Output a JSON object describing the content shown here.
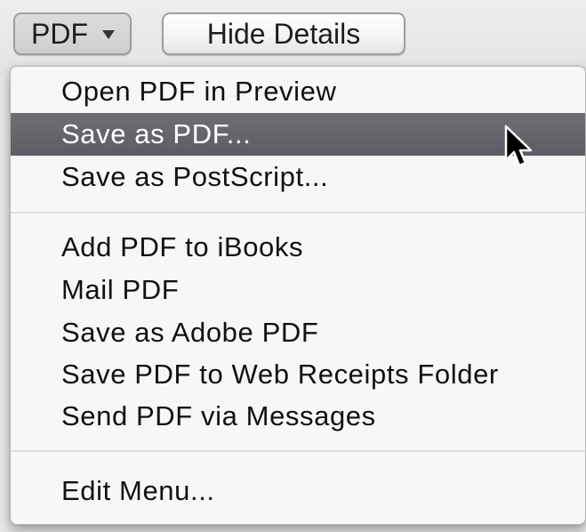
{
  "toolbar": {
    "pdf_label": "PDF",
    "hide_details_label": "Hide Details"
  },
  "menu": {
    "items": [
      {
        "label": "Open PDF in Preview"
      },
      {
        "label": "Save as PDF..."
      },
      {
        "label": "Save as PostScript..."
      },
      {
        "label": "Add PDF to iBooks"
      },
      {
        "label": "Mail PDF"
      },
      {
        "label": "Save as Adobe PDF"
      },
      {
        "label": "Save PDF to Web Receipts Folder"
      },
      {
        "label": "Send PDF via Messages"
      },
      {
        "label": "Edit Menu..."
      }
    ],
    "highlighted_index": 1,
    "highlight_color": "#62646a"
  },
  "icons": {
    "dropdown": "chevron-down-icon",
    "pointer": "mouse-pointer-icon"
  }
}
